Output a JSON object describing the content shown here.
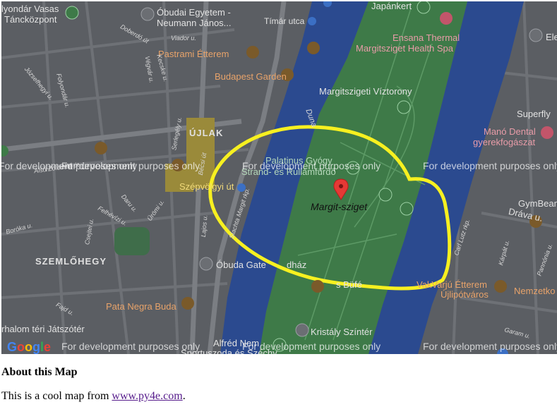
{
  "map": {
    "marker_label": "Margit-sziget",
    "dev_watermark": "For development purposes only",
    "google_logo": {
      "g1": "G",
      "o1": "o",
      "o2": "o",
      "g2": "g",
      "l": "l",
      "e": "e"
    },
    "places": {
      "mondar": "lyondár Vasas",
      "tanc": "Tánc­központ",
      "obuda_egy1": "Óbudai Egyetem -",
      "obuda_egy2": "Neumann János...",
      "timar": "Tímár utca",
      "japankert": "Japánkert",
      "ensana1": "Ensana Thermal",
      "ensana2": "Margitsziget Health Spa",
      "viztorony": "Margitszigeti Víztorony",
      "pastrami": "Pastrami Étterem",
      "budapest_garden": "Budapest Garden",
      "ujlak": "ÚJLAK",
      "superfly": "Superfly",
      "mano1": "Manó Dental",
      "mano2": "gyerekfogászat",
      "palatinus": "Palatinus Gyógy",
      "strand": "Strand- és Rullámfürdő",
      "szepvolgyi": "Szépvölgyi út",
      "gymbeam": "GymBeam",
      "szemlohegy": "SZEMLŐHEGY",
      "obuda_gat": "Óbuda Gate",
      "obuda_gat2": "dház",
      "pata": "Pata Negra Buda",
      "vakvarju1": "VakVarjú Étterem",
      "vakvarju2": "Újlipótváros",
      "nemzetko": "Nemzetko",
      "kristaly": "Kristály Színtér",
      "buffe": "s Büfé",
      "jatszoter": "rhalom téri Játszótér",
      "alfred": "Alfréd Nem",
      "sportuszoda": "Sportuszoda és Széchy",
      "ele": "Ele",
      "drava": "Dráva u.",
      "duna": "Duna"
    },
    "streets": {
      "dobrodo": "Doberdó út",
      "viador": "Viador u.",
      "kecske": "Kecske u.",
      "vegvar": "Végvár u.",
      "jozsef": "Józsefhegyi u.",
      "folyodar": "Folyondár u.",
      "serleg": "Serlegély u.",
      "becsi": "Bécsi út",
      "also": "Alsó Zöldmáli út",
      "daru": "Daru u.",
      "uromi": "Ürömi u.",
      "felhevizi": "Felhévízi u.",
      "boroka": "Boróka u.",
      "csejtei": "Csejtei u.",
      "lajos": "Lajos u.",
      "slachta": "Slachta Margit rkp.",
      "fajd": "Fajd u.",
      "carl": "Carl Lutz rkp.",
      "karpat": "Kárpát u.",
      "pannonia": "Pannónia u.",
      "garam": "Garam u."
    }
  },
  "about": {
    "heading": "About this Map",
    "text_before": "This is a cool map from ",
    "link_text": "www.py4e.com",
    "text_after": "."
  }
}
